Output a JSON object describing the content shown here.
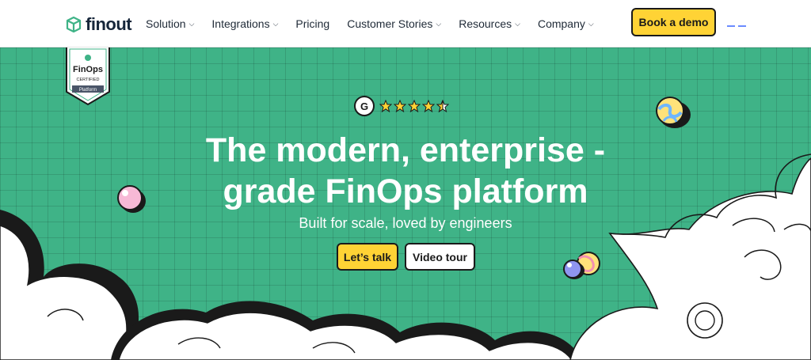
{
  "brand": {
    "name": "finout",
    "logo_icon": "box-logo-icon",
    "accent": "#3fb387"
  },
  "nav": {
    "items": [
      {
        "label": "Solution",
        "dropdown": true
      },
      {
        "label": "Integrations",
        "dropdown": true
      },
      {
        "label": "Pricing",
        "dropdown": false
      },
      {
        "label": "Customer Stories",
        "dropdown": true
      },
      {
        "label": "Resources",
        "dropdown": true
      },
      {
        "label": "Company",
        "dropdown": true
      }
    ],
    "cta_label": "Book a demo",
    "cta_color": "#ffd335"
  },
  "badge": {
    "title": "FinOps",
    "line1": "CERTIFIED",
    "line2": "Platform"
  },
  "rating": {
    "provider": "G",
    "stars": 4.5,
    "max_stars": 5
  },
  "hero": {
    "title_line1": "The modern, enterprise -",
    "title_line2": "grade FinOps platform",
    "subtitle": "Built for scale, loved by engineers",
    "primary_button": "Let’s talk",
    "secondary_button": "Video tour"
  }
}
